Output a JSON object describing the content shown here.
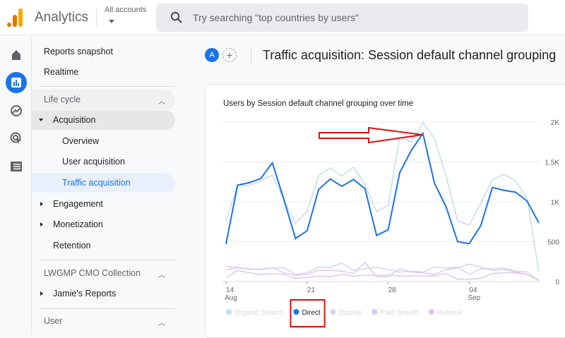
{
  "header": {
    "app_name": "Analytics",
    "accounts_label": "All accounts",
    "search_placeholder": "Try searching \"top countries by users\""
  },
  "rail": {
    "icons": [
      "home-icon",
      "reports-icon",
      "explore-icon",
      "advertising-icon",
      "list-icon"
    ],
    "active": "reports-icon",
    "accent": "#1a73e8"
  },
  "nav": {
    "reports_snapshot": "Reports snapshot",
    "realtime": "Realtime",
    "life_cycle": "Life cycle",
    "acquisition": "Acquisition",
    "overview": "Overview",
    "user_acquisition": "User acquisition",
    "traffic_acquisition": "Traffic acquisition",
    "engagement": "Engagement",
    "monetization": "Monetization",
    "retention": "Retention",
    "collection": "LWGMP CMO Collection",
    "jamies_reports": "Jamie's Reports",
    "user": "User"
  },
  "main": {
    "avatar_letter": "A",
    "add_label": "+",
    "title": "Traffic acquisition: Session default channel grouping"
  },
  "chart_data": {
    "type": "line",
    "title": "Users by Session default channel grouping over time",
    "x": [
      "Aug 14",
      "Aug 15",
      "Aug 16",
      "Aug 17",
      "Aug 18",
      "Aug 19",
      "Aug 20",
      "Aug 21",
      "Aug 22",
      "Aug 23",
      "Aug 24",
      "Aug 25",
      "Aug 26",
      "Aug 27",
      "Aug 28",
      "Aug 29",
      "Aug 30",
      "Aug 31",
      "Sep 1",
      "Sep 2",
      "Sep 3",
      "Sep 4",
      "Sep 5",
      "Sep 6",
      "Sep 7",
      "Sep 8",
      "Sep 9",
      "Sep 10"
    ],
    "x_ticks": [
      {
        "day": "14",
        "month": "Aug",
        "index": 0
      },
      {
        "day": "21",
        "month": "",
        "index": 7
      },
      {
        "day": "28",
        "month": "",
        "index": 14
      },
      {
        "day": "04",
        "month": "Sep",
        "index": 21
      }
    ],
    "y_ticks": [
      "0",
      "500",
      "1K",
      "1.5K",
      "2K"
    ],
    "ylim": [
      0,
      2000
    ],
    "grid": true,
    "legend_position": "bottom-left",
    "series": [
      {
        "name": "Organic Search",
        "color": "#c6dcec",
        "values": [
          767,
          1204,
          1204,
          1262,
          1336,
          1027,
          726,
          879,
          1327,
          1425,
          1322,
          1434,
          1218,
          879,
          953,
          1808,
          1749,
          1994,
          1794,
          1322,
          761,
          708,
          982,
          1277,
          1345,
          1262,
          1041,
          127
        ]
      },
      {
        "name": "Direct",
        "color": "#1a73e8",
        "values": [
          472,
          1209,
          1239,
          1292,
          1490,
          1027,
          540,
          637,
          1156,
          1286,
          1195,
          1280,
          1165,
          578,
          649,
          1366,
          1646,
          1858,
          1233,
          938,
          501,
          475,
          702,
          1180,
          1144,
          1121,
          1009,
          737
        ]
      },
      {
        "name": "Display",
        "color": "#d4d4f7",
        "values": [
          190,
          180,
          150,
          160,
          170,
          170,
          90,
          110,
          180,
          180,
          230,
          140,
          160,
          180,
          150,
          120,
          130,
          120,
          180,
          170,
          180,
          90,
          160,
          160,
          170,
          130,
          120,
          10
        ]
      },
      {
        "name": "Paid Search",
        "color": "#dcc9ee",
        "values": [
          150,
          170,
          160,
          150,
          170,
          110,
          80,
          90,
          140,
          140,
          130,
          100,
          240,
          60,
          60,
          160,
          120,
          110,
          90,
          150,
          170,
          220,
          180,
          140,
          150,
          120,
          90,
          10
        ]
      },
      {
        "name": "Referral",
        "color": "#e0c6ec",
        "values": [
          50,
          140,
          110,
          90,
          100,
          90,
          40,
          50,
          70,
          60,
          90,
          70,
          80,
          80,
          80,
          70,
          70,
          70,
          70,
          100,
          30,
          30,
          40,
          100,
          110,
          110,
          90,
          20
        ]
      }
    ],
    "highlighted_series": "Direct",
    "annotation_color": "#e01010"
  }
}
